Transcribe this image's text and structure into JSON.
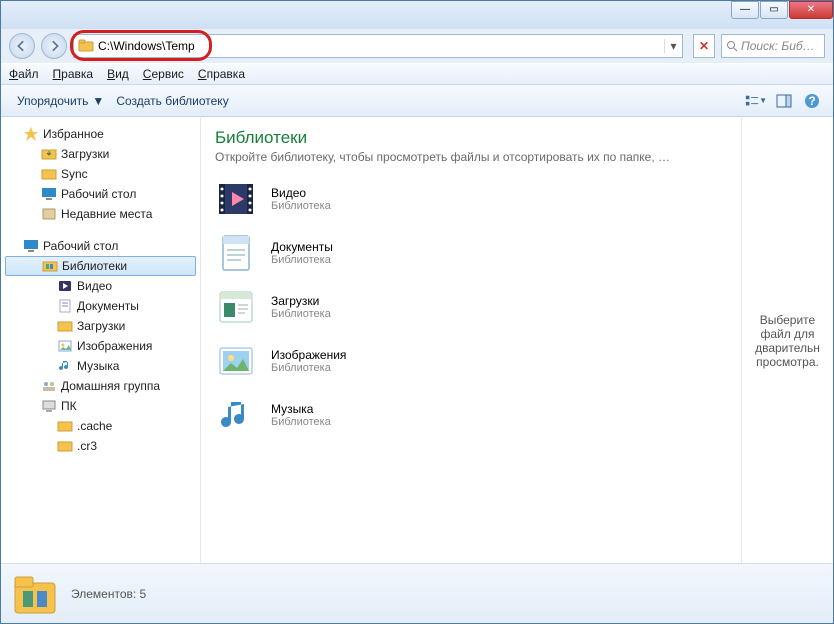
{
  "titlebar": {
    "min": "—",
    "max": "▭",
    "close": "✕"
  },
  "nav": {
    "address": "C:\\Windows\\Temp",
    "search_placeholder": "Поиск: Биб…"
  },
  "menu": {
    "file": "Файл",
    "edit": "Правка",
    "view": "Вид",
    "service": "Сервис",
    "help": "Справка"
  },
  "toolbar": {
    "organize": "Упорядочить",
    "create_lib": "Создать библиотеку"
  },
  "sidebar": {
    "favorites": "Избранное",
    "fav_items": [
      "Загрузки",
      "Sync",
      "Рабочий стол",
      "Недавние места"
    ],
    "desktop": "Рабочий стол",
    "libraries": "Библиотеки",
    "lib_items": [
      "Видео",
      "Документы",
      "Загрузки",
      "Изображения",
      "Музыка"
    ],
    "homegroup": "Домашняя группа",
    "pc": "ПК",
    "pc_items": [
      ".cache",
      ".cr3"
    ]
  },
  "content": {
    "heading": "Библиотеки",
    "subheading": "Откройте библиотеку, чтобы просмотреть файлы и отсортировать их по папке, …",
    "items": [
      {
        "name": "Видео",
        "sub": "Библиотека"
      },
      {
        "name": "Документы",
        "sub": "Библиотека"
      },
      {
        "name": "Загрузки",
        "sub": "Библиотека"
      },
      {
        "name": "Изображения",
        "sub": "Библиотека"
      },
      {
        "name": "Музыка",
        "sub": "Библиотека"
      }
    ]
  },
  "preview": {
    "text": "Выберите файл для дварительн просмотра."
  },
  "status": {
    "text": "Элементов: 5"
  }
}
